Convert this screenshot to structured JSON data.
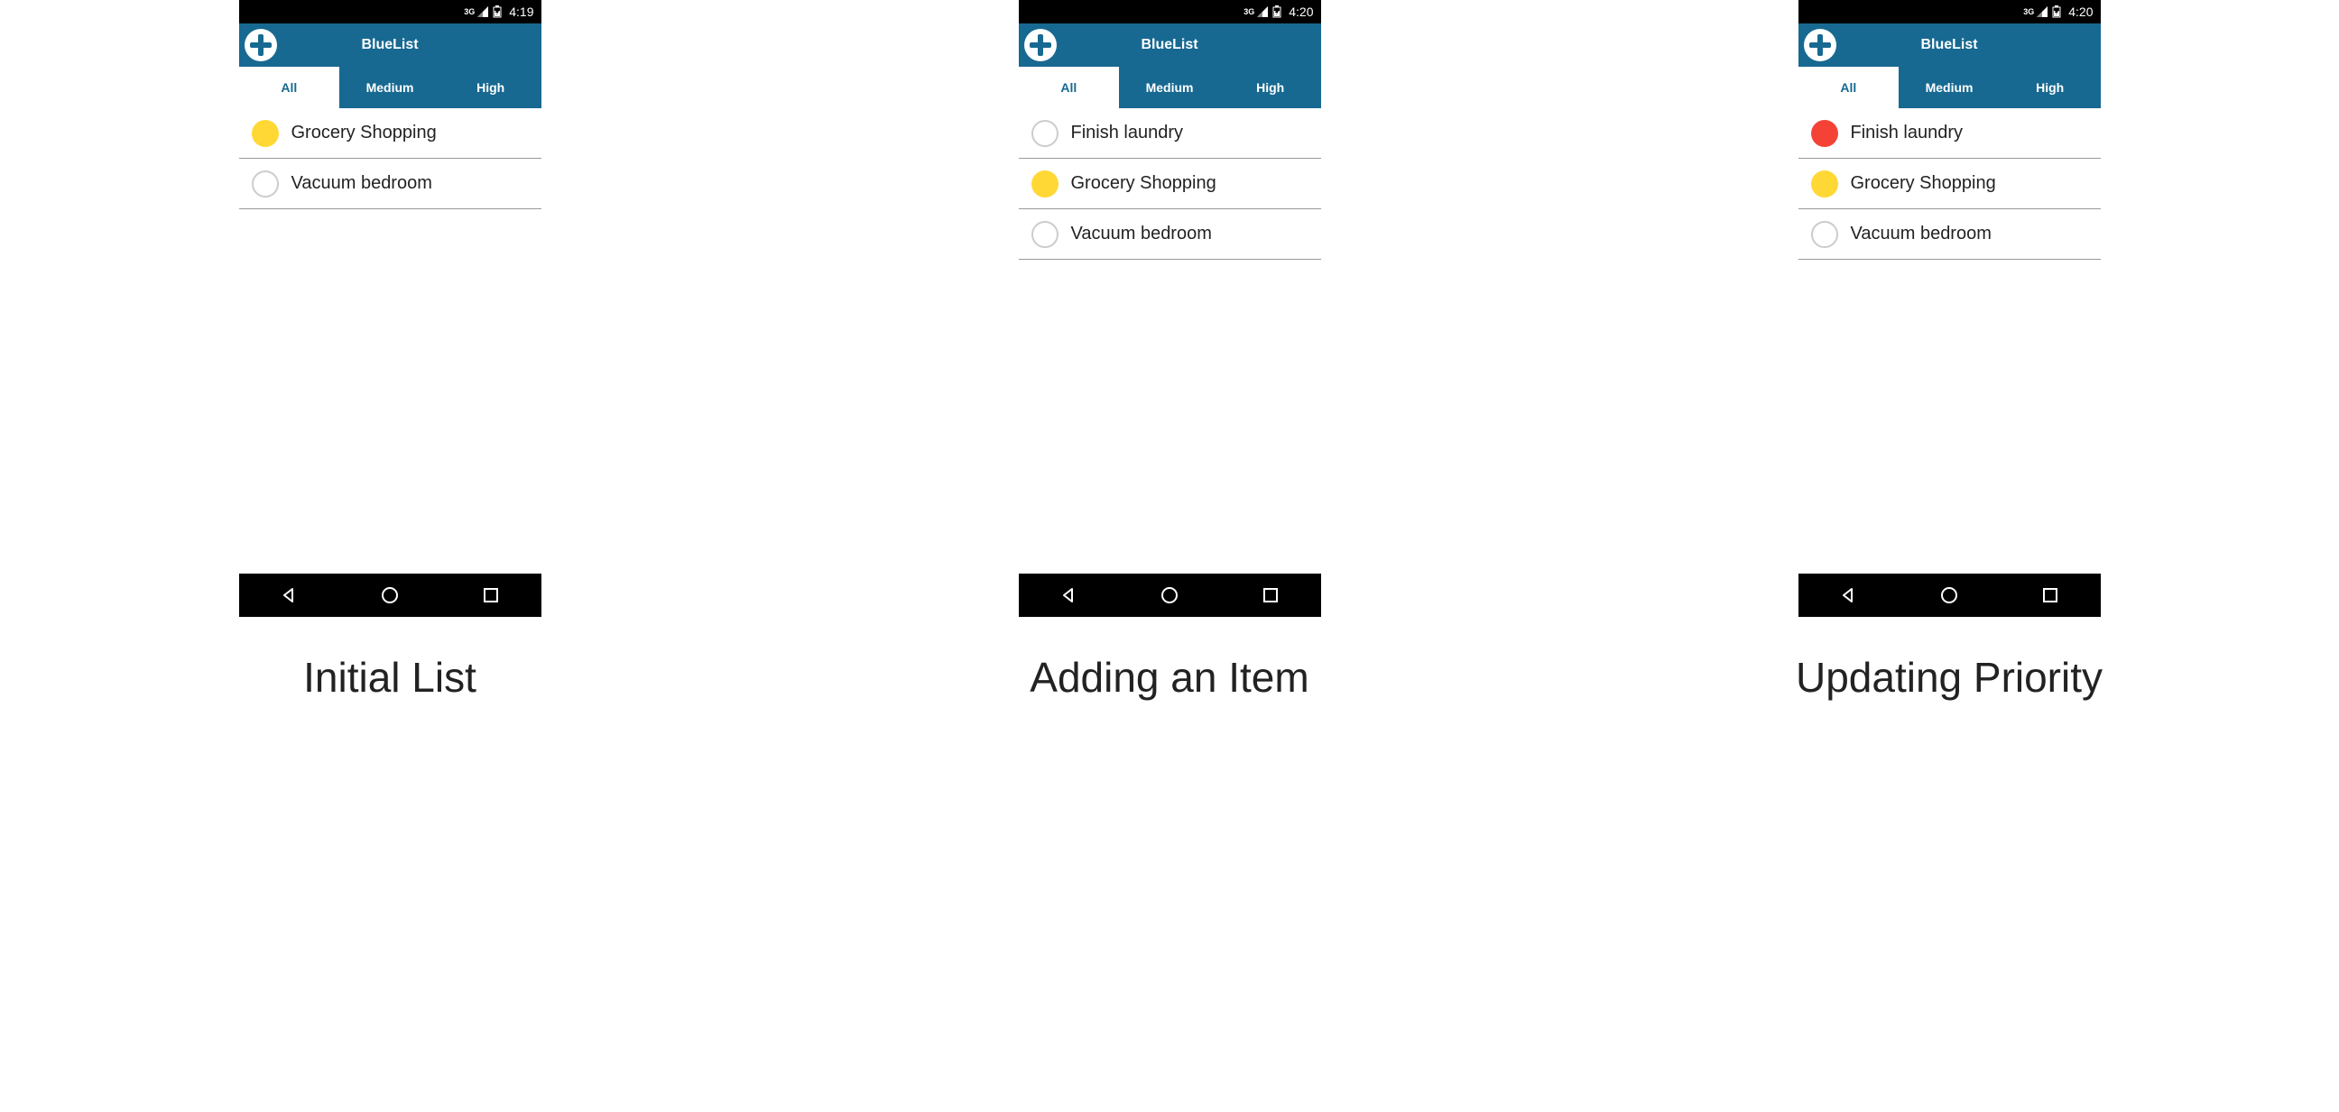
{
  "colors": {
    "header_bg": "#176991",
    "dot_medium": "#ffd835",
    "dot_high": "#f44336"
  },
  "status_network": "3G",
  "screens": [
    {
      "time": "4:19",
      "app_title": "BlueList",
      "tabs": [
        "All",
        "Medium",
        "High"
      ],
      "active_tab": 0,
      "items": [
        {
          "label": "Grocery Shopping",
          "priority": "medium"
        },
        {
          "label": "Vacuum bedroom",
          "priority": "none"
        }
      ],
      "caption": "Initial List"
    },
    {
      "time": "4:20",
      "app_title": "BlueList",
      "tabs": [
        "All",
        "Medium",
        "High"
      ],
      "active_tab": 0,
      "items": [
        {
          "label": "Finish laundry",
          "priority": "none"
        },
        {
          "label": "Grocery Shopping",
          "priority": "medium"
        },
        {
          "label": "Vacuum bedroom",
          "priority": "none"
        }
      ],
      "caption": "Adding an Item"
    },
    {
      "time": "4:20",
      "app_title": "BlueList",
      "tabs": [
        "All",
        "Medium",
        "High"
      ],
      "active_tab": 0,
      "items": [
        {
          "label": "Finish laundry",
          "priority": "high"
        },
        {
          "label": "Grocery Shopping",
          "priority": "medium"
        },
        {
          "label": "Vacuum bedroom",
          "priority": "none"
        }
      ],
      "caption": "Updating Priority"
    }
  ]
}
